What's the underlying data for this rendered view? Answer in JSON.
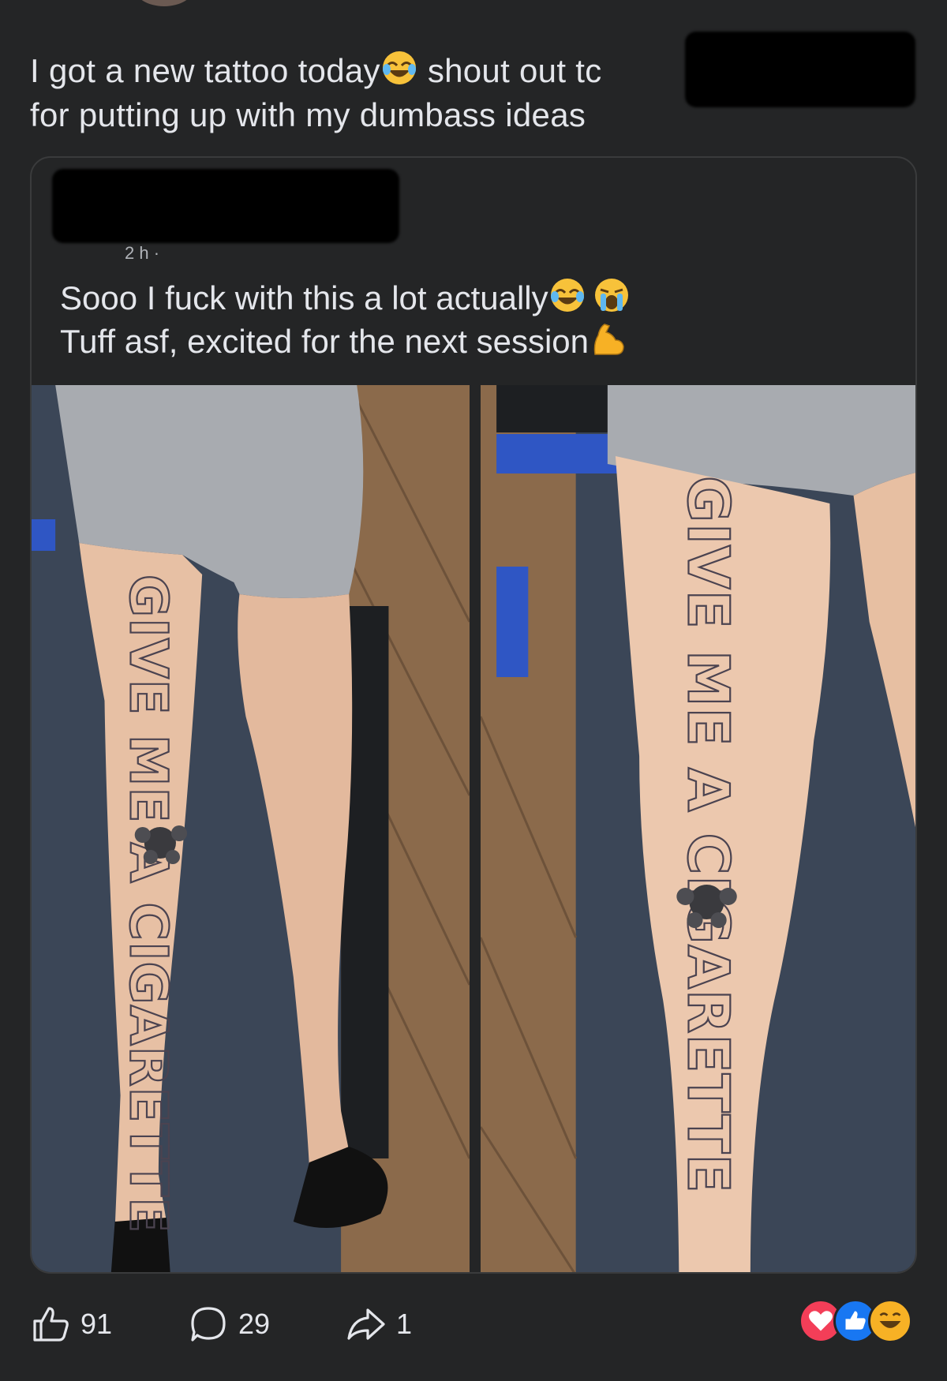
{
  "post": {
    "text_line1_a": "I got a new tattoo today",
    "text_line1_b": " shout out tc",
    "text_line2": "for putting up with my dumbass ideas",
    "emoji_1": "joy-emoji"
  },
  "shared_post": {
    "meta": "2 h ·",
    "text_line1": "Sooo I fuck with this a lot actually",
    "text_line2": "Tuff asf, excited for the next session",
    "emojis": [
      "joy-emoji",
      "loudly-crying-emoji",
      "flexed-biceps-emoji"
    ],
    "photos": [
      {
        "tattoo_text": "GIVE ME A CIGARETTE"
      },
      {
        "tattoo_text": "GIVE ME A CIGARETTE"
      }
    ]
  },
  "actions": {
    "like_count": "91",
    "comment_count": "29",
    "share_count": "1"
  },
  "reactions": [
    "love-icon",
    "like-icon",
    "haha-icon"
  ],
  "colors": {
    "background": "#242526",
    "text": "#e4e6eb",
    "love": "#f33e58",
    "like": "#1877f2",
    "haha": "#f7b125"
  }
}
